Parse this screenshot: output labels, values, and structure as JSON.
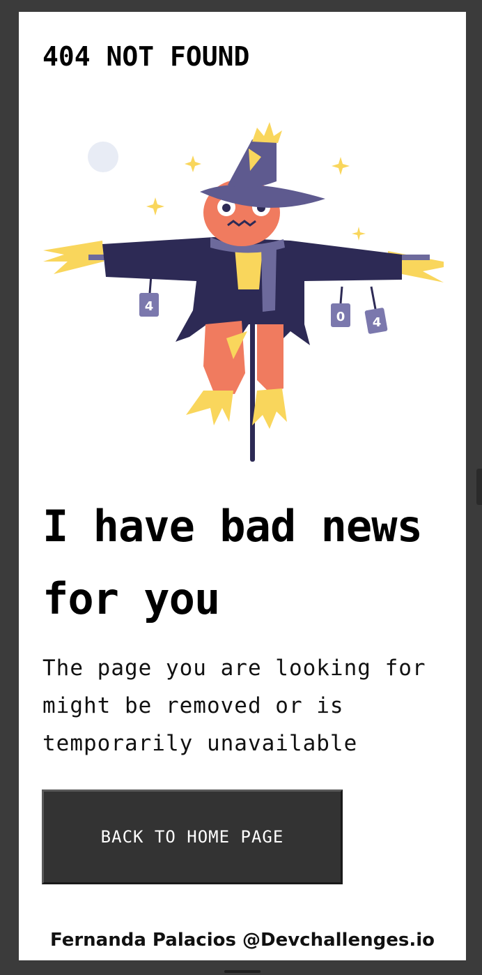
{
  "header": {
    "brand": "404 NOT FOUND"
  },
  "illustration": {
    "subject": "scarecrow",
    "cans": [
      "4",
      "0",
      "4"
    ],
    "colors": {
      "hat": "#5e5a8f",
      "coat": "#2d2a55",
      "face": "#f07b5f",
      "straw": "#f9d65c",
      "moon": "#e8ecf5"
    }
  },
  "main": {
    "headline": "I have bad news for you",
    "description": "The page you are looking for might be removed or is temporarily unavailable",
    "cta_label": "BACK TO HOME PAGE"
  },
  "footer": {
    "credit": "Fernanda Palacios @Devchallenges.io"
  }
}
